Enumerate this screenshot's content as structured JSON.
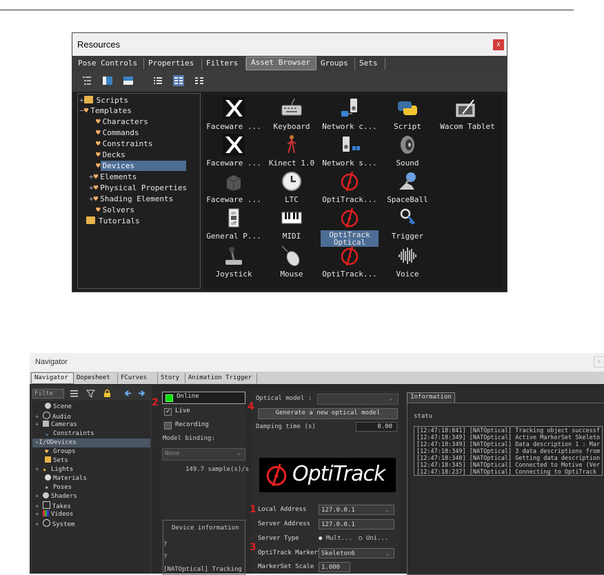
{
  "resources": {
    "title": "Resources",
    "close": "x",
    "tabs": [
      {
        "label": "Pose Controls",
        "active": false
      },
      {
        "label": "Properties",
        "active": false
      },
      {
        "label": "Filters",
        "active": false
      },
      {
        "label": "Asset Browser",
        "active": true
      },
      {
        "label": "Groups",
        "active": false
      },
      {
        "label": "Sets",
        "active": false
      }
    ],
    "tree": [
      {
        "label": "Scripts",
        "icon": "folder-icon",
        "level": 0,
        "expander": "+"
      },
      {
        "label": "Templates",
        "icon": "template-icon",
        "level": 0,
        "expander": "-"
      },
      {
        "label": "Characters",
        "icon": "template-icon",
        "level": 1
      },
      {
        "label": "Commands",
        "icon": "template-icon",
        "level": 1
      },
      {
        "label": "Constraints",
        "icon": "template-icon",
        "level": 1
      },
      {
        "label": "Decks",
        "icon": "template-icon",
        "level": 1
      },
      {
        "label": "Devices",
        "icon": "template-icon",
        "level": 1,
        "selected": true
      },
      {
        "label": "Elements",
        "icon": "template-icon",
        "level": 1,
        "expander": "+"
      },
      {
        "label": "Physical Properties",
        "icon": "template-icon",
        "level": 1,
        "expander": "+"
      },
      {
        "label": "Shading Elements",
        "icon": "template-icon",
        "level": 1,
        "expander": "+"
      },
      {
        "label": "Solvers",
        "icon": "template-icon",
        "level": 1
      },
      {
        "label": "Tutorials",
        "icon": "folder-icon",
        "level": 0
      }
    ],
    "devices": [
      [
        "Faceware ...",
        "Keyboard",
        "Network c...",
        "Script",
        "Wacom Tablet"
      ],
      [
        "Faceware ...",
        "Kinect 1.0",
        "Network s...",
        "Sound"
      ],
      [
        "Faceware ...",
        "LTC",
        "OptiTrack...",
        "SpaceBall"
      ],
      [
        "General P...",
        "MIDI",
        "OptiTrack\nOptical",
        "Trigger"
      ],
      [
        "Joystick",
        "Mouse",
        "OptiTrack...",
        "Voice"
      ]
    ],
    "device_icons": [
      [
        "faceware-icon",
        "keyboard-icon",
        "network-client-icon",
        "python-script-icon",
        "wacom-tablet-icon"
      ],
      [
        "faceware-icon",
        "kinect-icon",
        "network-server-icon",
        "sound-icon"
      ],
      [
        "faceware-box-icon",
        "clock-icon",
        "optitrack-icon",
        "spaceball-icon"
      ],
      [
        "switch-icon",
        "midi-keyboard-icon",
        "optitrack-icon",
        "trigger-key-icon"
      ],
      [
        "joystick-icon",
        "mouse-icon",
        "optitrack-icon",
        "waveform-icon"
      ]
    ]
  },
  "navigator": {
    "title": "Navigator",
    "close": "x",
    "tabs": [
      {
        "label": "Navigator",
        "active": true
      },
      {
        "label": "Dopesheet",
        "active": false
      },
      {
        "label": "FCurves",
        "active": false
      },
      {
        "label": "Story",
        "active": false
      },
      {
        "label": "Animation Trigger",
        "active": false
      }
    ],
    "filter_placeholder": "Filte",
    "tree": [
      {
        "label": "Scene",
        "expander": ""
      },
      {
        "label": "Audio",
        "expander": "+"
      },
      {
        "label": "Cameras",
        "expander": "+"
      },
      {
        "label": "Constraints",
        "expander": ""
      },
      {
        "label": "Devices",
        "expander": "+",
        "prefix": "I/O",
        "selected": true
      },
      {
        "label": "Groups",
        "expander": ""
      },
      {
        "label": "Sets",
        "expander": ""
      },
      {
        "label": "Lights",
        "expander": "+"
      },
      {
        "label": "Materials",
        "expander": ""
      },
      {
        "label": "Poses",
        "expander": ""
      },
      {
        "label": "Shaders",
        "expander": "+"
      },
      {
        "label": "Takes",
        "expander": "+"
      },
      {
        "label": "Videos",
        "expander": "+"
      },
      {
        "label": "System",
        "expander": "+"
      }
    ],
    "device": {
      "online_label": "Online",
      "live_label": "Live",
      "live_checked": true,
      "recording_label": "Recording",
      "recording_checked": false,
      "model_binding_label": "Model binding:",
      "model_binding_value": "None",
      "sample_rate": "149.7 sample(s)/s",
      "device_info_label": "Device information",
      "info_line1": "?",
      "info_line2": "?",
      "info_line3": "[NATOptical] Tracking o"
    },
    "optical": {
      "optical_model_label": "Optical model :",
      "generate_button": "Generate a new optical model",
      "damping_label": "Damping time (s)",
      "damping_value": "0.00",
      "logo_text": "OptiTrack",
      "local_address_label": "Local Address",
      "local_address_value": "127.0.0.1",
      "server_address_label": "Server Address",
      "server_address_value": "127.0.0.1",
      "server_type_label": "Server Type",
      "server_type_multicast": "Mult...",
      "server_type_unicast": "Uni...",
      "markerset_label": "OptiTrack MarkerS",
      "markerset_value": "Skeleton6",
      "markerset_scale_label": "MarkerSet Scale",
      "markerset_scale_value": "1.000",
      "markers": [
        "1",
        "2",
        "3",
        "4"
      ]
    },
    "information": {
      "tab_label": "Information",
      "status_label": "statu",
      "log": [
        "[12:47:18:841] [NATOptical] Tracking object successf",
        "[12:47:18:349] [NATOptical] Active MarkerSet Skeleto",
        "[12:47:18:349] [NATOptical] Data description 1 : Mar",
        "[12:47:18:349] [NATOptical] 3 data descriptions from",
        "[12:47:18:348] [NATOptical] Getting data description",
        "[12:47:18:345] [NATOptical] Connected to Motive (Ver",
        "[12:47:18:237] [NATOptical] Connecting to OptiTrack"
      ]
    }
  },
  "colors": {
    "selection": "#4d6d95",
    "optitrack_red": "#e02020",
    "online_green": "#00e000"
  }
}
